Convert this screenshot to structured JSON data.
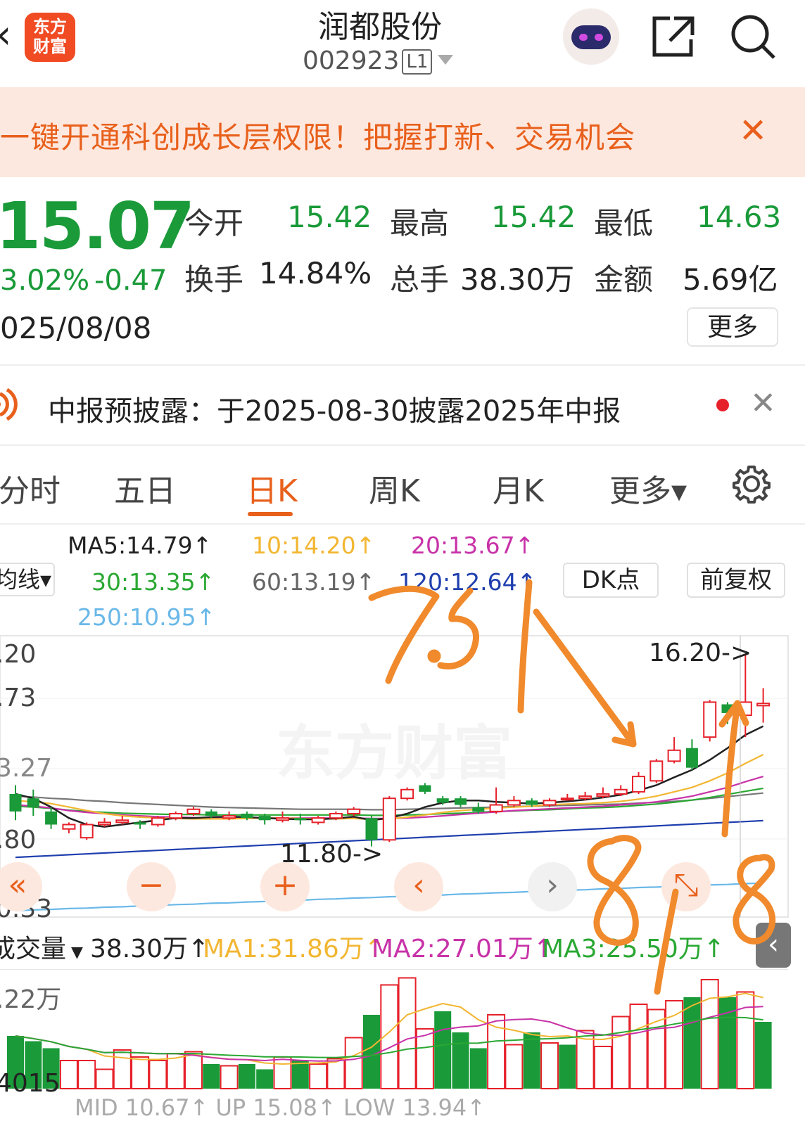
{
  "header": {
    "back_icon": "‹",
    "logo_text_top": "东方",
    "logo_text_bottom": "财富",
    "title": "润都股份",
    "code": "002923",
    "level": "L1"
  },
  "banner": {
    "text": "一键开通科创成长层权限！把握打新、交易机会",
    "close": "✕"
  },
  "quote": {
    "price": "15.07",
    "change_pct": "3.02%",
    "change_amt": "-0.47",
    "date": "025/08/08",
    "fields": [
      {
        "label": "今开",
        "value": "15.42",
        "green": true
      },
      {
        "label": "最高",
        "value": "15.42",
        "green": true
      },
      {
        "label": "最低",
        "value": "14.63",
        "green": true
      },
      {
        "label": "换手",
        "value": "14.84%",
        "green": false
      },
      {
        "label": "总手",
        "value": "38.30万",
        "green": false
      },
      {
        "label": "金额",
        "value": "5.69亿",
        "green": false
      }
    ],
    "more_label": "更多"
  },
  "notice": {
    "text": "中报预披露：于2025-08-30披露2025年中报",
    "close": "✕"
  },
  "tabs": [
    {
      "label": "分时",
      "active": false
    },
    {
      "label": "五日",
      "active": false
    },
    {
      "label": "日K",
      "active": true
    },
    {
      "label": "周K",
      "active": false
    },
    {
      "label": "月K",
      "active": false
    },
    {
      "label": "更多▾",
      "active": false
    }
  ],
  "ma_legend": {
    "ma5": "MA5:14.79↑",
    "ma10": "10:14.20↑",
    "ma20": "20:13.67↑",
    "ma30": "30:13.35↑",
    "ma60": "60:13.19↑",
    "ma120": "120:12.64↑",
    "ma250": "250:10.95↑",
    "left_select": "均线▾",
    "dk_label": "DK点",
    "adjust_label": "前复权"
  },
  "colors": {
    "up": "#e6212a",
    "down": "#1a9a39",
    "ma5": "#222222",
    "ma10": "#f2b632",
    "ma20": "#c832a8",
    "ma30": "#2aa833",
    "ma60": "#777777",
    "ma120": "#1f3fae",
    "ma250": "#6ab8e8",
    "accent": "#e8601c"
  },
  "chart": {
    "y_labels": [
      ".20",
      ".73",
      "3.27",
      ".80",
      "0.33"
    ],
    "high_mark": "16.20->",
    "low_mark": "11.80->",
    "watermark": "东方财富",
    "controls": [
      "«",
      "−",
      "+",
      "‹",
      "›",
      "⤡"
    ]
  },
  "volume": {
    "selector": "成交量",
    "current": "38.30万↑",
    "ma1": "MA1:31.86万↑",
    "ma2": "MA2:27.01万↑",
    "ma3": "MA3:25.50万↑",
    "y_top": ".22万",
    "y_bottom": "4015",
    "bottom_cut": "MID 10.67↑  UP 15.08↑  LOW 13.94↑"
  },
  "annotations": {
    "note1": "7.31",
    "note2": "8/8"
  },
  "candles": [
    {
      "o": 13.0,
      "c": 12.6,
      "h": 13.2,
      "l": 12.4
    },
    {
      "o": 12.9,
      "c": 12.7,
      "h": 13.1,
      "l": 12.5
    },
    {
      "o": 12.6,
      "c": 12.3,
      "h": 12.7,
      "l": 12.2
    },
    {
      "o": 12.2,
      "c": 12.3,
      "h": 12.35,
      "l": 12.1
    },
    {
      "o": 12.0,
      "c": 12.3,
      "h": 12.35,
      "l": 11.95
    },
    {
      "o": 12.3,
      "c": 12.35,
      "h": 12.45,
      "l": 12.25
    },
    {
      "o": 12.35,
      "c": 12.4,
      "h": 12.5,
      "l": 12.3
    },
    {
      "o": 12.35,
      "c": 12.3,
      "h": 12.4,
      "l": 12.2
    },
    {
      "o": 12.3,
      "c": 12.45,
      "h": 12.5,
      "l": 12.25
    },
    {
      "o": 12.45,
      "c": 12.55,
      "h": 12.6,
      "l": 12.4
    },
    {
      "o": 12.55,
      "c": 12.65,
      "h": 12.7,
      "l": 12.5
    },
    {
      "o": 12.6,
      "c": 12.5,
      "h": 12.65,
      "l": 12.45
    },
    {
      "o": 12.45,
      "c": 12.5,
      "h": 12.6,
      "l": 12.4
    },
    {
      "o": 12.55,
      "c": 12.45,
      "h": 12.6,
      "l": 12.4
    },
    {
      "o": 12.5,
      "c": 12.4,
      "h": 12.55,
      "l": 12.3
    },
    {
      "o": 12.4,
      "c": 12.45,
      "h": 12.6,
      "l": 12.35
    },
    {
      "o": 12.45,
      "c": 12.4,
      "h": 12.55,
      "l": 12.3
    },
    {
      "o": 12.35,
      "c": 12.45,
      "h": 12.5,
      "l": 12.3
    },
    {
      "o": 12.45,
      "c": 12.55,
      "h": 12.6,
      "l": 12.4
    },
    {
      "o": 12.55,
      "c": 12.65,
      "h": 12.7,
      "l": 12.5
    },
    {
      "o": 12.45,
      "c": 11.95,
      "h": 12.5,
      "l": 11.8
    },
    {
      "o": 11.95,
      "c": 12.9,
      "h": 12.95,
      "l": 11.9
    },
    {
      "o": 12.9,
      "c": 13.1,
      "h": 13.15,
      "l": 12.85
    },
    {
      "o": 13.2,
      "c": 13.05,
      "h": 13.25,
      "l": 13.0
    },
    {
      "o": 12.9,
      "c": 12.8,
      "h": 12.95,
      "l": 12.75
    },
    {
      "o": 12.9,
      "c": 12.75,
      "h": 12.95,
      "l": 12.7
    },
    {
      "o": 12.7,
      "c": 12.6,
      "h": 12.8,
      "l": 12.55
    },
    {
      "o": 12.6,
      "c": 12.75,
      "h": 13.15,
      "l": 12.55
    },
    {
      "o": 12.75,
      "c": 12.85,
      "h": 12.95,
      "l": 12.7
    },
    {
      "o": 12.85,
      "c": 12.75,
      "h": 12.9,
      "l": 12.7
    },
    {
      "o": 12.75,
      "c": 12.85,
      "h": 12.9,
      "l": 12.7
    },
    {
      "o": 12.9,
      "c": 12.9,
      "h": 13.0,
      "l": 12.85
    },
    {
      "o": 12.9,
      "c": 12.95,
      "h": 13.05,
      "l": 12.85
    },
    {
      "o": 12.95,
      "c": 13.0,
      "h": 13.15,
      "l": 12.9
    },
    {
      "o": 13.0,
      "c": 13.1,
      "h": 13.2,
      "l": 12.95
    },
    {
      "o": 13.05,
      "c": 13.4,
      "h": 13.5,
      "l": 13.0
    },
    {
      "o": 13.3,
      "c": 13.75,
      "h": 13.8,
      "l": 13.25
    },
    {
      "o": 13.75,
      "c": 14.0,
      "h": 14.3,
      "l": 13.7
    },
    {
      "o": 14.05,
      "c": 13.6,
      "h": 14.25,
      "l": 13.55
    },
    {
      "o": 14.3,
      "c": 15.1,
      "h": 15.15,
      "l": 14.2
    },
    {
      "o": 15.05,
      "c": 14.85,
      "h": 15.1,
      "l": 14.6
    },
    {
      "o": 14.8,
      "c": 15.1,
      "h": 16.2,
      "l": 14.3
    },
    {
      "o": 15.02,
      "c": 15.07,
      "h": 15.42,
      "l": 14.63
    }
  ],
  "ma_lines": {
    "ma5": [
      13.0,
      12.9,
      12.7,
      12.45,
      12.3,
      12.25,
      12.3,
      12.35,
      12.4,
      12.45,
      12.45,
      12.47,
      12.48,
      12.47,
      12.45,
      12.43,
      12.42,
      12.42,
      12.44,
      12.48,
      12.4,
      12.45,
      12.55,
      12.7,
      12.8,
      12.85,
      12.85,
      12.82,
      12.8,
      12.78,
      12.8,
      12.83,
      12.87,
      12.92,
      12.98,
      13.08,
      13.2,
      13.38,
      13.55,
      13.78,
      14.05,
      14.35,
      14.55
    ],
    "ma10": [
      12.85,
      12.82,
      12.78,
      12.7,
      12.62,
      12.55,
      12.5,
      12.47,
      12.45,
      12.44,
      12.43,
      12.43,
      12.43,
      12.44,
      12.45,
      12.45,
      12.44,
      12.43,
      12.43,
      12.44,
      12.42,
      12.43,
      12.47,
      12.52,
      12.58,
      12.62,
      12.65,
      12.68,
      12.7,
      12.72,
      12.75,
      12.77,
      12.78,
      12.8,
      12.83,
      12.88,
      12.95,
      13.05,
      13.15,
      13.3,
      13.48,
      13.7,
      13.9
    ],
    "ma20": [
      12.75,
      12.72,
      12.68,
      12.62,
      12.58,
      12.55,
      12.52,
      12.5,
      12.48,
      12.47,
      12.46,
      12.45,
      12.45,
      12.45,
      12.45,
      12.45,
      12.45,
      12.45,
      12.45,
      12.45,
      12.44,
      12.44,
      12.45,
      12.47,
      12.5,
      12.53,
      12.56,
      12.59,
      12.62,
      12.64,
      12.66,
      12.68,
      12.7,
      12.72,
      12.75,
      12.78,
      12.82,
      12.88,
      12.95,
      13.05,
      13.15,
      13.28,
      13.4
    ],
    "ma30": [
      12.72,
      12.7,
      12.67,
      12.63,
      12.6,
      12.58,
      12.56,
      12.55,
      12.54,
      12.53,
      12.53,
      12.52,
      12.52,
      12.52,
      12.52,
      12.52,
      12.52,
      12.52,
      12.52,
      12.52,
      12.51,
      12.51,
      12.52,
      12.53,
      12.55,
      12.56,
      12.58,
      12.6,
      12.61,
      12.63,
      12.64,
      12.66,
      12.68,
      12.69,
      12.71,
      12.74,
      12.77,
      12.81,
      12.86,
      12.92,
      12.99,
      13.06,
      13.13
    ],
    "ma60": [
      12.95,
      12.93,
      12.9,
      12.88,
      12.85,
      12.83,
      12.8,
      12.78,
      12.76,
      12.74,
      12.72,
      12.7,
      12.69,
      12.68,
      12.67,
      12.66,
      12.65,
      12.65,
      12.65,
      12.65,
      12.64,
      12.64,
      12.65,
      12.66,
      12.67,
      12.68,
      12.69,
      12.7,
      12.71,
      12.72,
      12.73,
      12.74,
      12.75,
      12.76,
      12.77,
      12.79,
      12.81,
      12.83,
      12.86,
      12.9,
      12.94,
      12.98,
      13.02
    ],
    "ma120": [
      11.55,
      11.57,
      11.59,
      11.61,
      11.63,
      11.65,
      11.67,
      11.69,
      11.71,
      11.73,
      11.75,
      11.77,
      11.79,
      11.81,
      11.83,
      11.85,
      11.87,
      11.89,
      11.91,
      11.93,
      11.95,
      11.97,
      11.99,
      12.01,
      12.03,
      12.05,
      12.07,
      12.09,
      12.11,
      12.13,
      12.15,
      12.17,
      12.19,
      12.21,
      12.23,
      12.25,
      12.27,
      12.29,
      12.31,
      12.33,
      12.35,
      12.37,
      12.39
    ],
    "ma250": [
      10.33,
      10.35,
      10.36,
      10.38,
      10.39,
      10.41,
      10.42,
      10.44,
      10.45,
      10.47,
      10.48,
      10.5,
      10.51,
      10.53,
      10.54,
      10.56,
      10.57,
      10.59,
      10.6,
      10.62,
      10.63,
      10.65,
      10.66,
      10.68,
      10.69,
      10.71,
      10.72,
      10.74,
      10.75,
      10.77,
      10.78,
      10.8,
      10.81,
      10.83,
      10.84,
      10.86,
      10.87,
      10.89,
      10.9,
      10.92,
      10.93,
      10.95,
      10.96
    ]
  },
  "volumes": [
    {
      "v": 30,
      "up": false
    },
    {
      "v": 27,
      "up": false
    },
    {
      "v": 23,
      "up": false
    },
    {
      "v": 16,
      "up": true
    },
    {
      "v": 16,
      "up": true
    },
    {
      "v": 11,
      "up": true
    },
    {
      "v": 22,
      "up": true
    },
    {
      "v": 18,
      "up": true
    },
    {
      "v": 16,
      "up": true
    },
    {
      "v": 20,
      "up": true
    },
    {
      "v": 21,
      "up": true
    },
    {
      "v": 14,
      "up": false
    },
    {
      "v": 13,
      "up": true
    },
    {
      "v": 14,
      "up": false
    },
    {
      "v": 11,
      "up": false
    },
    {
      "v": 18,
      "up": true
    },
    {
      "v": 16,
      "up": false
    },
    {
      "v": 14,
      "up": true
    },
    {
      "v": 17,
      "up": true
    },
    {
      "v": 29,
      "up": true
    },
    {
      "v": 42,
      "up": false
    },
    {
      "v": 59,
      "up": true
    },
    {
      "v": 63,
      "up": true
    },
    {
      "v": 34,
      "up": true
    },
    {
      "v": 44,
      "up": false
    },
    {
      "v": 32,
      "up": false
    },
    {
      "v": 23,
      "up": false
    },
    {
      "v": 42,
      "up": true
    },
    {
      "v": 25,
      "up": true
    },
    {
      "v": 32,
      "up": false
    },
    {
      "v": 26,
      "up": true
    },
    {
      "v": 25,
      "up": false
    },
    {
      "v": 33,
      "up": true
    },
    {
      "v": 24,
      "up": true
    },
    {
      "v": 41,
      "up": true
    },
    {
      "v": 48,
      "up": true
    },
    {
      "v": 45,
      "up": true
    },
    {
      "v": 50,
      "up": true
    },
    {
      "v": 52,
      "up": false
    },
    {
      "v": 62,
      "up": true
    },
    {
      "v": 52,
      "up": false
    },
    {
      "v": 55,
      "up": true
    },
    {
      "v": 38,
      "up": false
    }
  ]
}
